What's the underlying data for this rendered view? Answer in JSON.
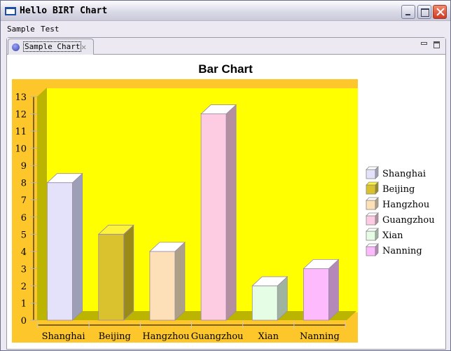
{
  "window": {
    "title": "Hello BIRT Chart"
  },
  "menu": {
    "items": [
      "Sample",
      "Test"
    ]
  },
  "tab": {
    "label": "Sample Chart"
  },
  "colors": {
    "plot_bg": "#ffff00",
    "chart_bg": "#fdc62b",
    "wall_side": "#bbb400"
  },
  "chart_data": {
    "type": "bar",
    "title": "Bar Chart",
    "categories": [
      "Shanghai",
      "Beijing",
      "Hangzhou",
      "Guangzhou",
      "Xian",
      "Nanning"
    ],
    "values": [
      8,
      5,
      4,
      12,
      2,
      3
    ],
    "series_colors": [
      "#e4e2fa",
      "#d9c22d",
      "#fde0b8",
      "#fdcbe2",
      "#e4fde4",
      "#fdbafd"
    ],
    "side_colors": [
      "#9c9fb6",
      "#9a8a18",
      "#ae9f87",
      "#b48f9f",
      "#9fb49f",
      "#b488b8"
    ],
    "ylim": [
      0,
      13
    ],
    "yticks": [
      "0",
      "1",
      "2",
      "3",
      "4",
      "5",
      "6",
      "7",
      "8",
      "9",
      "10",
      "11",
      "12",
      "13"
    ],
    "xlabel": "",
    "ylabel": "",
    "legend": {
      "position": "right",
      "entries": [
        "Shanghai",
        "Beijing",
        "Hangzhou",
        "Guangzhou",
        "Xian",
        "Nanning"
      ]
    },
    "style": "3d"
  }
}
